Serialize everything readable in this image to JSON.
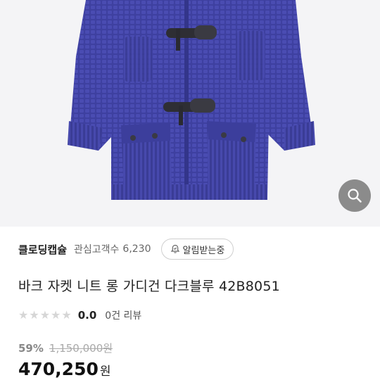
{
  "product": {
    "shop_name": "클로딩캡슐",
    "favorites_label": "관심고객수",
    "favorites_count": "6,230",
    "alert_button_label": "알림받는중",
    "title": "바크 자켓 니트 롱 가디건 다크블루 42B8051",
    "rating": {
      "stars": 5,
      "filled": 0,
      "score": "0.0",
      "reviews_label": "0건 리뷰"
    },
    "discount_percent": "59%",
    "original_price": "1,150,000원",
    "price": "470,250",
    "currency": "원"
  },
  "icons": {
    "zoom": "search-icon",
    "alert": "bell-check-icon",
    "rating": "star-icon"
  },
  "colors": {
    "cardigan": "#3d3f9e",
    "zoom_button": "#787878"
  }
}
